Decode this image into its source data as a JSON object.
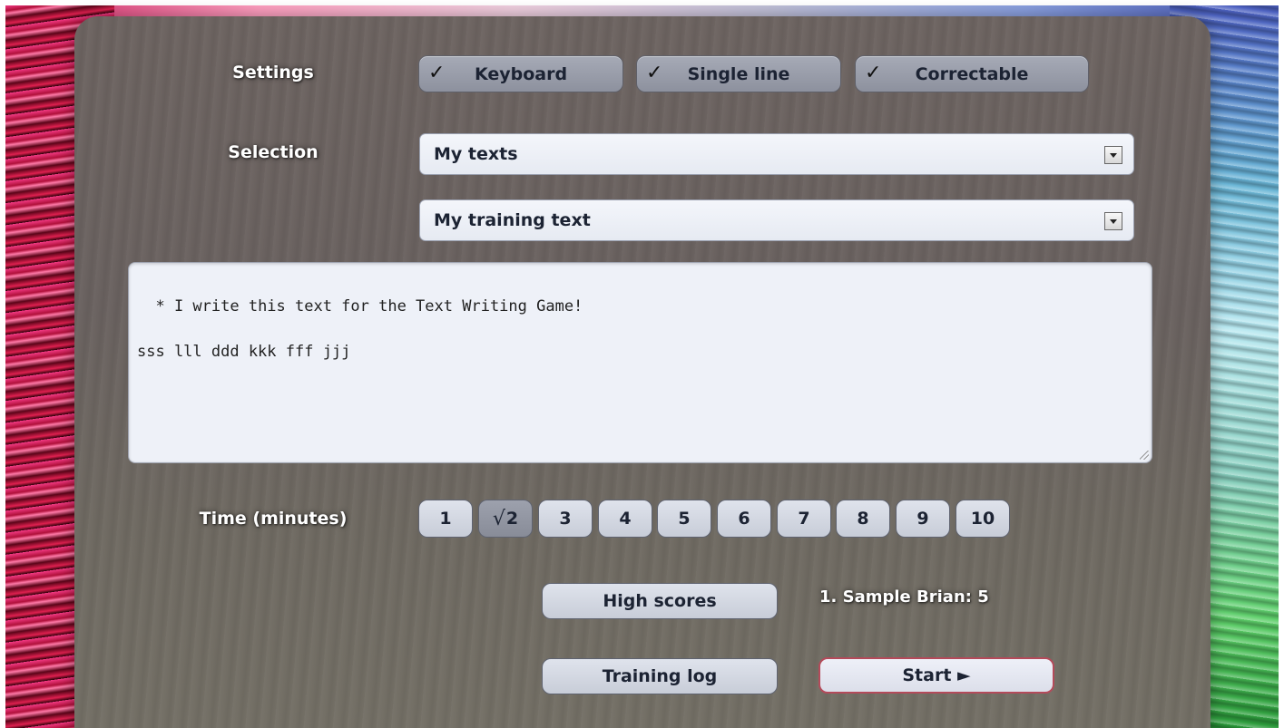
{
  "settings": {
    "label": "Settings",
    "toggles": [
      {
        "label": "Keyboard",
        "check": "✓"
      },
      {
        "label": "Single line",
        "check": "✓"
      },
      {
        "label": "Correctable",
        "check": "✓"
      }
    ]
  },
  "selection": {
    "label": "Selection",
    "category_value": "My texts",
    "text_value": "My training text"
  },
  "editor": {
    "content": "* I write this text for the Text Writing Game!\n\nsss lll ddd kkk fff jjj"
  },
  "time": {
    "label": "Time (minutes)",
    "selected_index": 1,
    "check_mark": "√",
    "options": [
      "1",
      "2",
      "3",
      "4",
      "5",
      "6",
      "7",
      "8",
      "9",
      "10"
    ]
  },
  "actions": {
    "high_scores_label": "High scores",
    "training_log_label": "Training log",
    "start_label": "Start ►"
  },
  "high_scores": {
    "top_entry": "1. Sample Brian: 5"
  },
  "colors": {
    "accent_border": "#b44a5a",
    "button_text": "#1c2333",
    "panel": "#6d6461"
  }
}
